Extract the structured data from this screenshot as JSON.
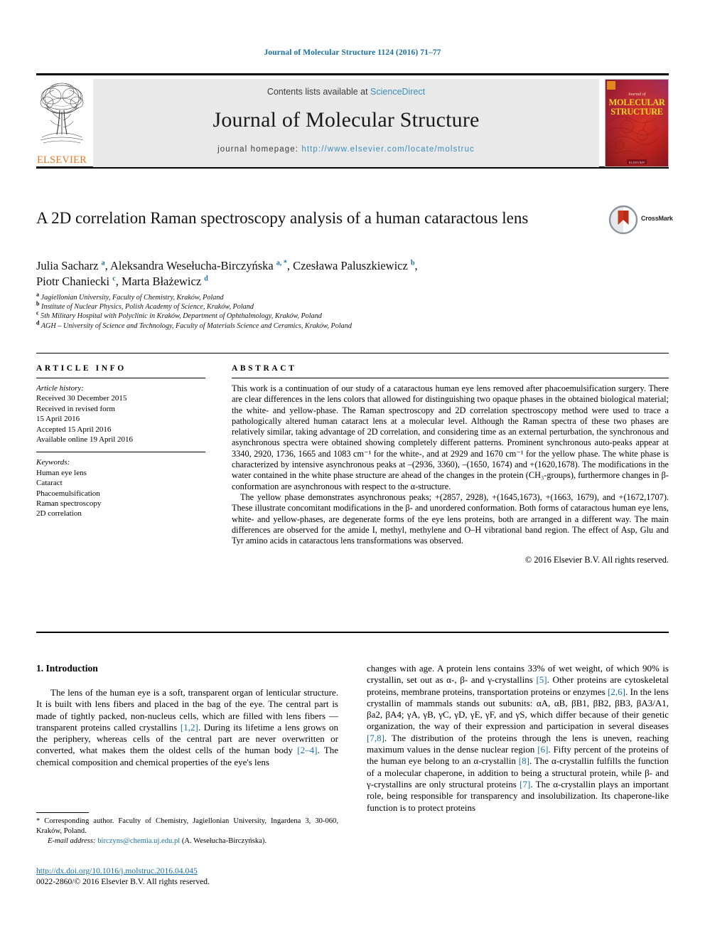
{
  "running_head": "Journal of Molecular Structure 1124 (2016) 71–77",
  "masthead": {
    "contents_prefix": "Contents lists available at ",
    "sciencedirect": "ScienceDirect",
    "journal_title": "Journal of Molecular Structure",
    "homepage_prefix": "journal homepage: ",
    "homepage_url": "http://www.elsevier.com/locate/molstruc",
    "publisher_wordmark": "ELSEVIER",
    "cover_title_line1": "MOLECULAR",
    "cover_title_line2": "STRUCTURE",
    "cover_title_small": "Journal of",
    "link_color": "#3a8dbd",
    "header_color": "#1a6ea0"
  },
  "article": {
    "title": "A 2D correlation Raman spectroscopy analysis of a human cataractous lens",
    "crossmark_label": "CrossMark",
    "authors_line1": "Julia Sacharz <sup>a</sup>, Aleksandra Wesełucha-Birczyńska <sup>a, *</sup>, Czesława Paluszkiewicz <sup>b</sup>,",
    "authors_line2": "Piotr Chaniecki <sup>c</sup>, Marta Błażewicz <sup>d</sup>",
    "affiliations": [
      {
        "marker": "a",
        "text": "Jagiellonian University, Faculty of Chemistry, Kraków, Poland"
      },
      {
        "marker": "b",
        "text": "Institute of Nuclear Physics, Polish Academy of Science, Kraków, Poland"
      },
      {
        "marker": "c",
        "text": "5th Military Hospital with Polyclinic in Kraków, Department of Ophthalmology, Kraków, Poland"
      },
      {
        "marker": "d",
        "text": "AGH – University of Science and Technology, Faculty of Materials Science and Ceramics, Kraków, Poland"
      }
    ]
  },
  "article_info": {
    "heading": "ARTICLE INFO",
    "history_label": "Article history:",
    "history": [
      "Received 30 December 2015",
      "Received in revised form",
      "15 April 2016",
      "Accepted 15 April 2016",
      "Available online 19 April 2016"
    ],
    "keywords_label": "Keywords:",
    "keywords": [
      "Human eye lens",
      "Cataract",
      "Phacoemulsification",
      "Raman spectroscopy",
      "2D correlation"
    ]
  },
  "abstract": {
    "heading": "ABSTRACT",
    "paragraph1": "This work is a continuation of our study of a cataractous human eye lens removed after phacoemulsification surgery. There are clear differences in the lens colors that allowed for distinguishing two opaque phases in the obtained biological material; the white- and yellow-phase. The Raman spectroscopy and 2D correlation spectroscopy method were used to trace a pathologically altered human cataract lens at a molecular level. Although the Raman spectra of these two phases are relatively similar, taking advantage of 2D correlation, and considering time as an external perturbation, the synchronous and asynchronous spectra were obtained showing completely different patterns. Prominent synchronous auto-peaks appear at 3340, 2920, 1736, 1665 and 1083 cm⁻¹ for the white-, and at 2929 and 1670 cm⁻¹ for the yellow phase. The white phase is characterized by intensive asynchronous peaks at –(2936, 3360), –(1650, 1674) and +(1620,1678). The modifications in the water contained in the white phase structure are ahead of the changes in the protein (CH₃-groups), furthermore changes in β-conformation are asynchronous with respect to the α-structure.",
    "paragraph2": "The yellow phase demonstrates asynchronous peaks; +(2857, 2928), +(1645,1673), +(1663, 1679), and +(1672,1707). These illustrate concomitant modifications in the β- and unordered conformation. Both forms of cataractous human eye lens, white- and yellow-phases, are degenerate forms of the eye lens proteins, both are arranged in a different way. The main differences are observed for the amide I, methyl, methylene and O–H vibrational band region. The effect of Asp, Glu and Tyr amino acids in cataractous lens transformations was observed.",
    "copyright": "© 2016 Elsevier B.V. All rights reserved."
  },
  "introduction": {
    "heading": "1. Introduction",
    "left_column": "The lens of the human eye is a soft, transparent organ of lenticular structure. It is built with lens fibers and placed in the bag of the eye. The central part is made of tightly packed, non-nucleus cells, which are filled with lens fibers — transparent proteins called crystallins <span class=\"ref\">[1,2]</span>. During its lifetime a lens grows on the periphery, whereas cells of the central part are never overwritten or converted, what makes them the oldest cells of the human body <span class=\"ref\">[2–4]</span>. The chemical composition and chemical properties of the eye's lens",
    "right_column": "changes with age. A protein lens contains 33% of wet weight, of which 90% is crystallin, set out as α-, β- and γ-crystallins <span class=\"ref\">[5]</span>. Other proteins are cytoskeletal proteins, membrane proteins, transportation proteins or enzymes <span class=\"ref\">[2,6]</span>. In the lens crystallin of mammals stands out subunits: αA, αB, βB1, βB2, βB3, βA3/A1, βa2, βA4; γA, γB, γC, γD, γE, γF, and γS, which differ because of their genetic organization, the way of their expression and participation in several diseases <span class=\"ref\">[7,8]</span>. The distribution of the proteins through the lens is uneven, reaching maximum values in the dense nuclear region <span class=\"ref\">[6]</span>. Fifty percent of the proteins of the human eye belong to an α-crystallin <span class=\"ref\">[8]</span>. The α-crystallin fulfills the function of a molecular chaperone, in addition to being a structural protein, while β- and γ-crystallins are only structural proteins <span class=\"ref\">[7]</span>. The α-crystallin plays an important role, being responsible for transparency and insolubilization. Its chaperone-like function is to protect proteins"
  },
  "footnote": {
    "corresponding": "* Corresponding author. Faculty of Chemistry, Jagiellonian University, Ingardena 3, 30-060, Kraków, Poland.",
    "email_label": "E-mail address:",
    "email": "birczyns@chemia.uj.edu.pl",
    "email_suffix": "(A. Wesełucha-Birczyńska)."
  },
  "footer": {
    "doi": "http://dx.doi.org/10.1016/j.molstruc.2016.04.045",
    "issn_line": "0022-2860/© 2016 Elsevier B.V. All rights reserved."
  }
}
